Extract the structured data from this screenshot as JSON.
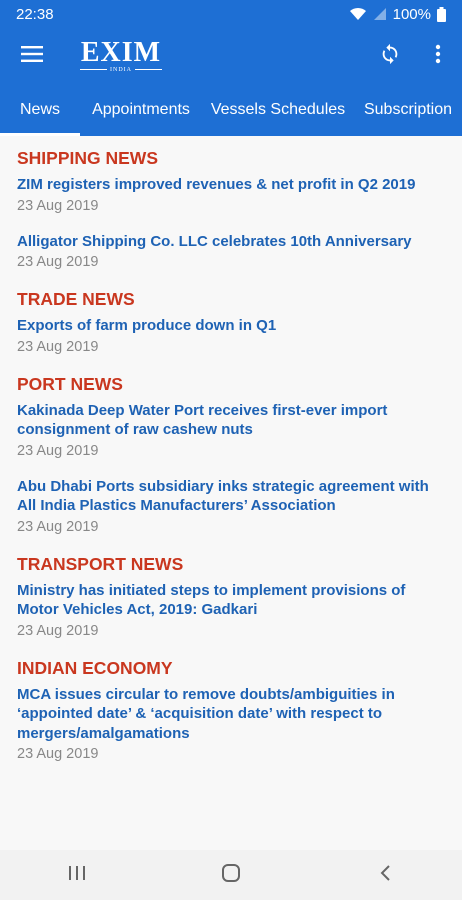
{
  "status_bar": {
    "time": "22:38",
    "battery": "100%"
  },
  "app_bar": {
    "logo_text": "EXIM",
    "logo_subtext": "INDIA"
  },
  "tabs": [
    {
      "label": "News"
    },
    {
      "label": "Appointments"
    },
    {
      "label": "Vessels Schedules"
    },
    {
      "label": "Subscription"
    }
  ],
  "sections": [
    {
      "title": "SHIPPING NEWS",
      "articles": [
        {
          "title": "ZIM registers improved revenues & net profit in Q2 2019",
          "date": "23 Aug 2019"
        },
        {
          "title": "Alligator Shipping Co. LLC celebrates 10th Anniversary",
          "date": "23 Aug 2019"
        }
      ]
    },
    {
      "title": "TRADE NEWS",
      "articles": [
        {
          "title": "Exports of farm produce down in Q1",
          "date": "23 Aug 2019"
        }
      ]
    },
    {
      "title": "PORT NEWS",
      "articles": [
        {
          "title": "Kakinada Deep Water Port receives first-ever import consignment of raw cashew nuts",
          "date": "23 Aug 2019"
        },
        {
          "title": "Abu Dhabi Ports subsidiary inks  strategic agreement with All India  Plastics Manufacturers’ Association",
          "date": "23 Aug 2019"
        }
      ]
    },
    {
      "title": "TRANSPORT NEWS",
      "articles": [
        {
          "title": "Ministry has initiated steps to implement  provisions of Motor Vehicles Act, 2019: Gadkari",
          "date": "23 Aug 2019"
        }
      ]
    },
    {
      "title": "INDIAN ECONOMY",
      "articles": [
        {
          "title": "MCA issues circular to remove doubts/ambiguities in ‘appointed date’ & ‘acquisition date’ with respect to mergers/amalgamations",
          "date": "23 Aug 2019"
        }
      ]
    }
  ],
  "icons": {
    "menu": "hamburger-menu-icon",
    "refresh": "refresh-icon",
    "overflow": "more-vertical-icon",
    "wifi": "wifi-icon",
    "signal": "signal-icon",
    "battery": "battery-icon",
    "nav_recents": "recents-icon",
    "nav_home": "home-icon",
    "nav_back": "back-icon"
  },
  "colors": {
    "primary": "#1e6fd4",
    "section_title": "#c9371f",
    "article_title": "#1e62b4",
    "date": "#888888"
  }
}
